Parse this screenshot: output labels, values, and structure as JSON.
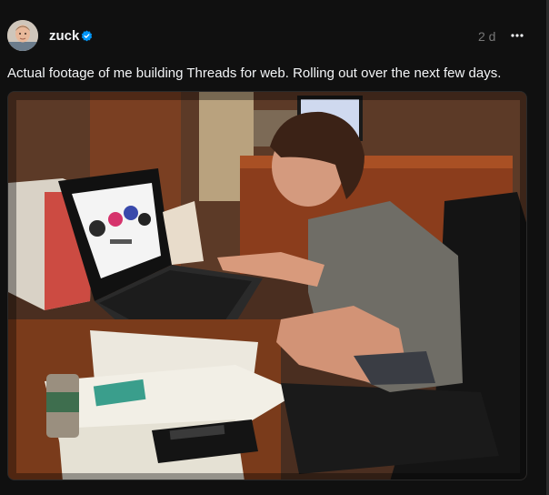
{
  "post": {
    "author": {
      "username": "zuck",
      "verified": true,
      "avatar_icon": "profile-photo"
    },
    "timestamp": "2 d",
    "more_icon": "ellipsis-horizontal-icon",
    "caption": "Actual footage of me building Threads for web. Rolling out over the next few days.",
    "media": {
      "type": "photo"
    }
  },
  "colors": {
    "background": "#101010",
    "text_primary": "#f3f5f7",
    "text_secondary": "#777777",
    "verified_blue": "#0095f6"
  }
}
